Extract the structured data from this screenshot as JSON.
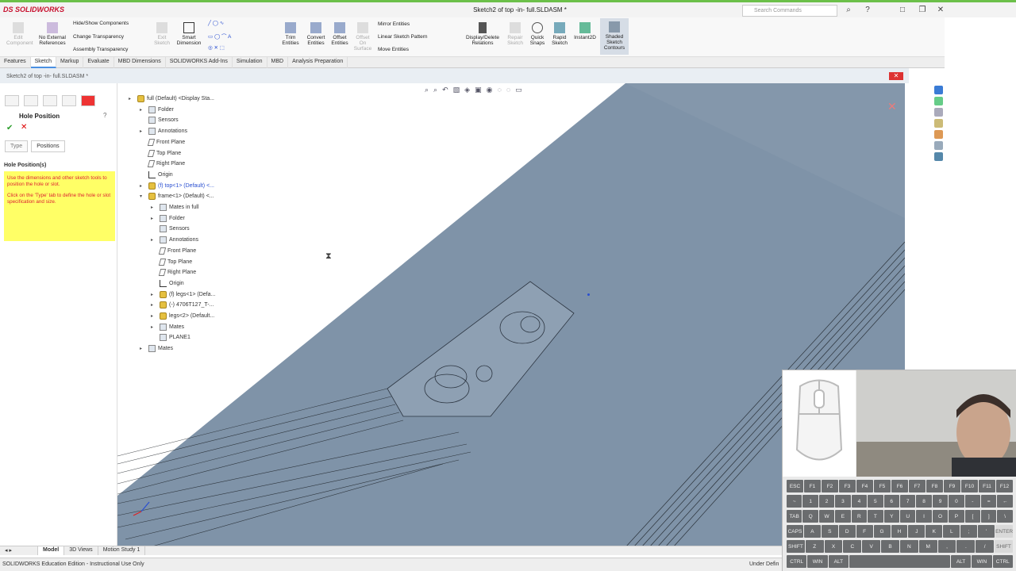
{
  "app": {
    "logo": "DS SOLIDWORKS",
    "doc_title": "Sketch2 of top -in- full.SLDASM *",
    "search_placeholder": "Search Commands"
  },
  "commands": {
    "edit_component": "Edit Component",
    "no_external_refs": "No External References",
    "hide_show": "Hide/Show Components",
    "change_transparency": "Change Transparency",
    "assembly_transparency": "Assembly Transparency",
    "exit_sketch": "Exit Sketch",
    "smart_dimension": "Smart Dimension",
    "trim_entities": "Trim Entities",
    "convert_entities": "Convert Entities",
    "offset_entities": "Offset Entities",
    "offset_on_surface": "Offset On Surface",
    "mirror_entities": "Mirror Entities",
    "linear_sketch_pattern": "Linear Sketch Pattern",
    "move_entities": "Move Entities",
    "display_delete_relations": "Display/Delete Relations",
    "repair_sketch": "Repair Sketch",
    "quick_snaps": "Quick Snaps",
    "rapid_sketch": "Rapid Sketch",
    "instant2d": "Instant2D",
    "shaded_sketch_contours": "Shaded Sketch Contours"
  },
  "tabs": [
    "Features",
    "Sketch",
    "Markup",
    "Evaluate",
    "MBD Dimensions",
    "SOLIDWORKS Add-Ins",
    "Simulation",
    "MBD",
    "Analysis Preparation"
  ],
  "active_tab": "Sketch",
  "doc_window_label": "Sketch2 of top -in- full.SLDASM *",
  "property_manager": {
    "title": "Hole Position",
    "type_tab": "Type",
    "positions_tab": "Positions",
    "section_title": "Hole Position(s)",
    "message_1": "Use the dimensions and other sketch tools to position the hole or slot.",
    "message_2": "Click on the 'Type' tab to define the hole or slot specification and size."
  },
  "tree": [
    {
      "label": "full (Default) <Display Sta...",
      "level": 0,
      "icon": "asm",
      "expand": "▸"
    },
    {
      "label": "Folder",
      "level": 1,
      "icon": "fold",
      "expand": "▸"
    },
    {
      "label": "Sensors",
      "level": 1,
      "icon": "fold",
      "expand": ""
    },
    {
      "label": "Annotations",
      "level": 1,
      "icon": "fold",
      "expand": "▸"
    },
    {
      "label": "Front Plane",
      "level": 1,
      "icon": "plane",
      "expand": ""
    },
    {
      "label": "Top Plane",
      "level": 1,
      "icon": "plane",
      "expand": ""
    },
    {
      "label": "Right Plane",
      "level": 1,
      "icon": "plane",
      "expand": ""
    },
    {
      "label": "Origin",
      "level": 1,
      "icon": "origin",
      "expand": ""
    },
    {
      "label": "(f) top<1> (Default) <...",
      "level": 1,
      "icon": "asm",
      "expand": "▸",
      "blue": true
    },
    {
      "label": "frame<1> (Default) <...",
      "level": 1,
      "icon": "asm",
      "expand": "▾"
    },
    {
      "label": "Mates in full",
      "level": 2,
      "icon": "fold",
      "expand": "▸"
    },
    {
      "label": "Folder",
      "level": 2,
      "icon": "fold",
      "expand": "▸"
    },
    {
      "label": "Sensors",
      "level": 2,
      "icon": "fold",
      "expand": ""
    },
    {
      "label": "Annotations",
      "level": 2,
      "icon": "fold",
      "expand": "▸"
    },
    {
      "label": "Front Plane",
      "level": 2,
      "icon": "plane",
      "expand": ""
    },
    {
      "label": "Top Plane",
      "level": 2,
      "icon": "plane",
      "expand": ""
    },
    {
      "label": "Right Plane",
      "level": 2,
      "icon": "plane",
      "expand": ""
    },
    {
      "label": "Origin",
      "level": 2,
      "icon": "origin",
      "expand": ""
    },
    {
      "label": "(f) legs<1> (Defa...",
      "level": 2,
      "icon": "asm",
      "expand": "▸"
    },
    {
      "label": "(-) 4706T127_T-...",
      "level": 2,
      "icon": "asm",
      "expand": "▸"
    },
    {
      "label": "legs<2> (Default...",
      "level": 2,
      "icon": "asm",
      "expand": "▸"
    },
    {
      "label": "Mates",
      "level": 2,
      "icon": "fold",
      "expand": "▸"
    },
    {
      "label": "PLANE1",
      "level": 2,
      "icon": "fold",
      "expand": ""
    },
    {
      "label": "Mates",
      "level": 1,
      "icon": "fold",
      "expand": "▸"
    }
  ],
  "bottom_tabs": [
    "Model",
    "3D Views",
    "Motion Study 1"
  ],
  "active_bottom_tab": "Model",
  "status": {
    "left": "SOLIDWORKS Education Edition - Instructional Use Only",
    "right": "Under Defin"
  },
  "keyboard": [
    [
      "ESC",
      "F1",
      "F2",
      "F3",
      "F4",
      "F5",
      "F6",
      "F7",
      "F8",
      "F9",
      "F10",
      "F11",
      "F12"
    ],
    [
      "~",
      "1",
      "2",
      "3",
      "4",
      "5",
      "6",
      "7",
      "8",
      "9",
      "0",
      "-",
      "=",
      "←"
    ],
    [
      "TAB",
      "Q",
      "W",
      "E",
      "R",
      "T",
      "Y",
      "U",
      "I",
      "O",
      "P",
      "[",
      "]",
      "\\"
    ],
    [
      "CAPS",
      "A",
      "S",
      "D",
      "F",
      "G",
      "H",
      "J",
      "K",
      "L",
      ";",
      "'",
      "ENTER"
    ],
    [
      "SHIFT",
      "Z",
      "X",
      "C",
      "V",
      "B",
      "N",
      "M",
      ",",
      ".",
      "/",
      "SHIFT"
    ],
    [
      "CTRL",
      "WIN",
      "ALT",
      "",
      "ALT",
      "WIN",
      "CTRL"
    ]
  ],
  "colors": {
    "accent_green": "#6cc04a",
    "viewport_blue": "#7f93a8",
    "message_yellow": "#ffff66"
  }
}
